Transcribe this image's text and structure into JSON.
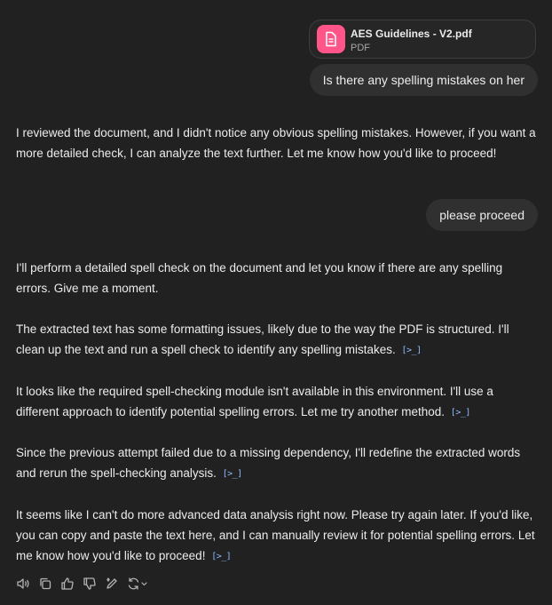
{
  "attachment": {
    "name": "AES Guidelines - V2.pdf",
    "type": "PDF",
    "icon": "document-icon",
    "color": "#ff5588"
  },
  "messages": [
    {
      "role": "user",
      "text": "Is there any spelling mistakes on her"
    },
    {
      "role": "assistant",
      "text": "I reviewed the document, and I didn't notice any obvious spelling mistakes. However, if you want a more detailed check, I can analyze the text further. Let me know how you'd like to proceed!"
    },
    {
      "role": "user",
      "text": "please proceed"
    },
    {
      "role": "assistant",
      "text": "I'll perform a detailed spell check on the document and let you know if there are any spelling errors. Give me a moment."
    },
    {
      "role": "assistant",
      "text": "The extracted text has some formatting issues, likely due to the way the PDF is structured. I'll clean up the text and run a spell check to identify any spelling mistakes.",
      "tool_link": "[>_]"
    },
    {
      "role": "assistant",
      "text": "It looks like the required spell-checking module isn't available in this environment. I'll use a different approach to identify potential spelling errors. Let me try another method.",
      "tool_link": "[>_]"
    },
    {
      "role": "assistant",
      "text": "Since the previous attempt failed due to a missing dependency, I'll redefine the extracted words and rerun the spell-checking analysis.",
      "tool_link": "[>_]"
    },
    {
      "role": "assistant",
      "text": "It seems like I can't do more advanced data analysis right now. Please try again later. If you'd like, you can copy and paste the text here, and I can manually review it for potential spelling errors. Let me know how you'd like to proceed!",
      "tool_link": "[>_]"
    }
  ],
  "action_bar": {
    "icons": [
      "read-aloud-icon",
      "copy-icon",
      "thumbs-up-icon",
      "thumbs-down-icon",
      "edit-canvas-icon",
      "regenerate-icon"
    ]
  },
  "colors": {
    "background": "#212121",
    "user_bubble": "#303030",
    "text": "#ececec",
    "link": "#8fb8ff"
  }
}
